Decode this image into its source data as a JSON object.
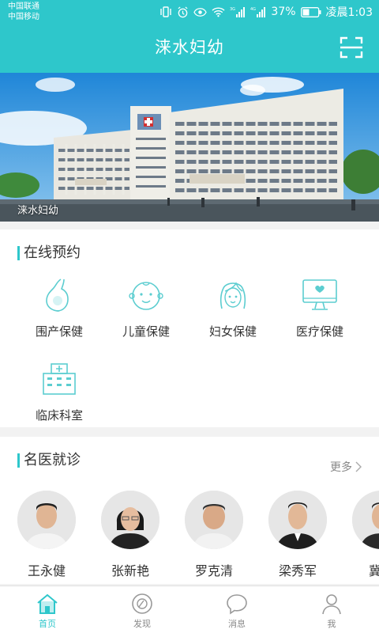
{
  "status_bar": {
    "carrier_1": "中国联通",
    "carrier_2": "中国移动",
    "battery": "37%",
    "time": "凌晨1:03"
  },
  "app_bar": {
    "title": "涞水妇幼",
    "scan_icon": "scan-icon"
  },
  "banner": {
    "caption": "涞水妇幼"
  },
  "online_booking": {
    "title": "在线预约",
    "items": [
      {
        "label": "围产保健",
        "icon": "pregnancy-icon"
      },
      {
        "label": "儿童保健",
        "icon": "child-face-icon"
      },
      {
        "label": "妇女保健",
        "icon": "woman-face-icon"
      },
      {
        "label": "医疗保健",
        "icon": "monitor-heart-icon"
      },
      {
        "label": "临床科室",
        "icon": "hospital-building-icon"
      }
    ]
  },
  "famous_doctors": {
    "title": "名医就诊",
    "more": "更多",
    "doctors": [
      {
        "name": "王永健"
      },
      {
        "name": "张新艳"
      },
      {
        "name": "罗克清"
      },
      {
        "name": "梁秀军"
      },
      {
        "name": "冀旺"
      }
    ]
  },
  "tab_bar": {
    "tabs": [
      {
        "label": "首页",
        "icon": "home-icon",
        "active": true
      },
      {
        "label": "发现",
        "icon": "compass-icon",
        "active": false
      },
      {
        "label": "消息",
        "icon": "chat-bubble-icon",
        "active": false
      },
      {
        "label": "我",
        "icon": "person-icon",
        "active": false
      }
    ]
  },
  "colors": {
    "accent": "#2ec7cb",
    "icon_teal": "#5ccdd0",
    "text": "#333333",
    "muted": "#888888"
  }
}
